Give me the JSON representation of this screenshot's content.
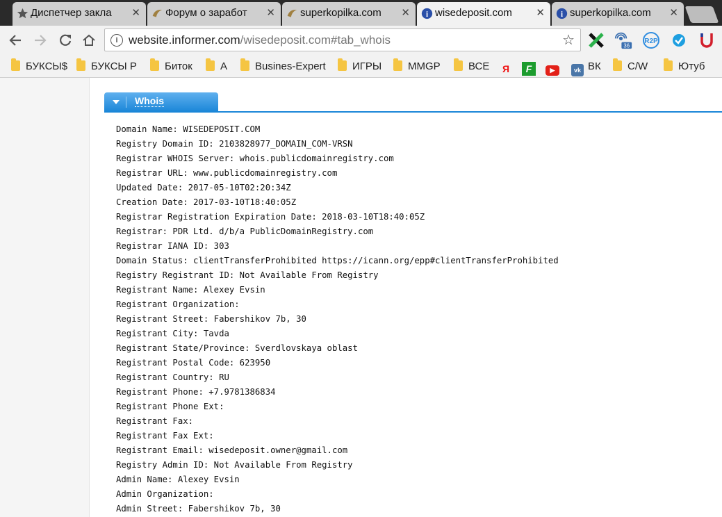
{
  "tabs": [
    {
      "title": "Диспетчер закла",
      "icon": "star-icon"
    },
    {
      "title": "Форум о заработ",
      "icon": "forum-favicon"
    },
    {
      "title": "superkopilka.com",
      "icon": "superkopilka-favicon"
    },
    {
      "title": "wisedeposit.com",
      "icon": "info-favicon"
    },
    {
      "title": "superkopilka.com",
      "icon": "info-favicon"
    }
  ],
  "toolbar": {
    "url_host": "website.informer.com",
    "url_rest": "/wisedeposit.com#tab_whois",
    "extension_badge": "36"
  },
  "bookmarks": [
    {
      "label": "БУКСЫ$",
      "type": "folder"
    },
    {
      "label": "БУКСЫ Р",
      "type": "folder"
    },
    {
      "label": "Биток",
      "type": "folder"
    },
    {
      "label": "А",
      "type": "folder"
    },
    {
      "label": "Busines-Expert",
      "type": "folder"
    },
    {
      "label": "ИГРЫ",
      "type": "folder"
    },
    {
      "label": "MMGP",
      "type": "folder"
    },
    {
      "label": "ВСЕ",
      "type": "folder"
    },
    {
      "label": "Я",
      "type": "yandex"
    },
    {
      "label": "F",
      "type": "green"
    },
    {
      "label": "▶",
      "type": "youtube"
    },
    {
      "label": "ВК",
      "type": "vk"
    },
    {
      "label": "C/W",
      "type": "folder"
    },
    {
      "label": "Ютуб",
      "type": "folder"
    }
  ],
  "whois": {
    "tab_label": "Whois",
    "lines": [
      "Domain Name: WISEDEPOSIT.COM",
      "Registry Domain ID: 2103828977_DOMAIN_COM-VRSN",
      "Registrar WHOIS Server: whois.publicdomainregistry.com",
      "Registrar URL: www.publicdomainregistry.com",
      "Updated Date: 2017-05-10T02:20:34Z",
      "Creation Date: 2017-03-10T18:40:05Z",
      "Registrar Registration Expiration Date: 2018-03-10T18:40:05Z",
      "Registrar: PDR Ltd. d/b/a PublicDomainRegistry.com",
      "Registrar IANA ID: 303",
      "Domain Status: clientTransferProhibited https://icann.org/epp#clientTransferProhibited",
      "Registry Registrant ID: Not Available From Registry",
      "Registrant Name: Alexey Evsin",
      "Registrant Organization:",
      "Registrant Street: Fabershikov 7b, 30",
      "Registrant City: Tavda",
      "Registrant State/Province: Sverdlovskaya oblast",
      "Registrant Postal Code: 623950",
      "Registrant Country: RU",
      "Registrant Phone: +7.9781386834",
      "Registrant Phone Ext:",
      "Registrant Fax:",
      "Registrant Fax Ext:",
      "Registrant Email: wisedeposit.owner@gmail.com",
      "Registry Admin ID: Not Available From Registry",
      "Admin Name: Alexey Evsin",
      "Admin Organization:",
      "Admin Street: Fabershikov 7b, 30"
    ]
  }
}
